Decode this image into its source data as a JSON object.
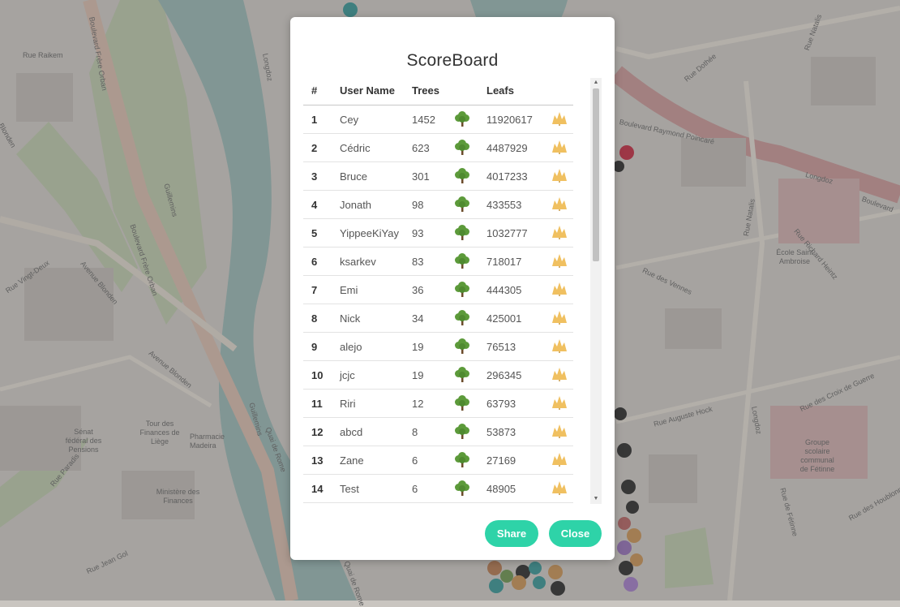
{
  "map": {
    "streets": [
      "Rue Raikem",
      "Boulevard Frère Orban",
      "Boulevard Frère Orban",
      "Guillemins",
      "Avenue Blonden",
      "Avenue Blonden",
      "Rue Vingt-Deux",
      "Blonden",
      "Rue Paradis",
      "Rue Jean Gol",
      "Quai de Rome",
      "Quai de Rome",
      "Guillemins",
      "Longdoz",
      "Rue Dothée",
      "Boulevard Raymond Poincaré",
      "Rue Natalis",
      "Rue Natalis",
      "Rue Richard Heintz",
      "Rue des Vennes",
      "Rue des Croix de Guerre",
      "Rue Auguste Hock",
      "Longdoz",
      "Rue de Fétinne",
      "Rue des Houblonnières",
      "Longdoz",
      "Boulevard"
    ],
    "pois": [
      "Sénat fédéral des Pensions",
      "Tour des Finances de Liège",
      "Pharmacie Madeira",
      "Ministère des Finances",
      "École Saint Ambroise",
      "Groupe scolaire communal de Fétinne"
    ]
  },
  "scoreboard": {
    "title": "ScoreBoard",
    "columns": {
      "rank": "#",
      "user": "User Name",
      "trees": "Trees",
      "leafs": "Leafs"
    },
    "tree_icon": "tree-icon",
    "leaf_icon": "leaf-icon",
    "rows": [
      {
        "rank": "1",
        "user": "Cey",
        "trees": "1452",
        "leafs": "11920617"
      },
      {
        "rank": "2",
        "user": "Cédric",
        "trees": "623",
        "leafs": "4487929"
      },
      {
        "rank": "3",
        "user": "Bruce",
        "trees": "301",
        "leafs": "4017233"
      },
      {
        "rank": "4",
        "user": "Jonath",
        "trees": "98",
        "leafs": "433553"
      },
      {
        "rank": "5",
        "user": "YippeeKiYay",
        "trees": "93",
        "leafs": "1032777"
      },
      {
        "rank": "6",
        "user": "ksarkev",
        "trees": "83",
        "leafs": "718017"
      },
      {
        "rank": "7",
        "user": "Emi",
        "trees": "36",
        "leafs": "444305"
      },
      {
        "rank": "8",
        "user": "Nick",
        "trees": "34",
        "leafs": "425001"
      },
      {
        "rank": "9",
        "user": "alejo",
        "trees": "19",
        "leafs": "76513"
      },
      {
        "rank": "10",
        "user": "jcjc",
        "trees": "19",
        "leafs": "296345"
      },
      {
        "rank": "11",
        "user": "Riri",
        "trees": "12",
        "leafs": "63793"
      },
      {
        "rank": "12",
        "user": "abcd",
        "trees": "8",
        "leafs": "53873"
      },
      {
        "rank": "13",
        "user": "Zane",
        "trees": "6",
        "leafs": "27169"
      },
      {
        "rank": "14",
        "user": "Test",
        "trees": "6",
        "leafs": "48905"
      }
    ],
    "share_label": "Share",
    "close_label": "Close"
  },
  "colors": {
    "accent": "#2ed3a8",
    "tree": "#5c9a3a",
    "leaf": "#f0c060"
  }
}
